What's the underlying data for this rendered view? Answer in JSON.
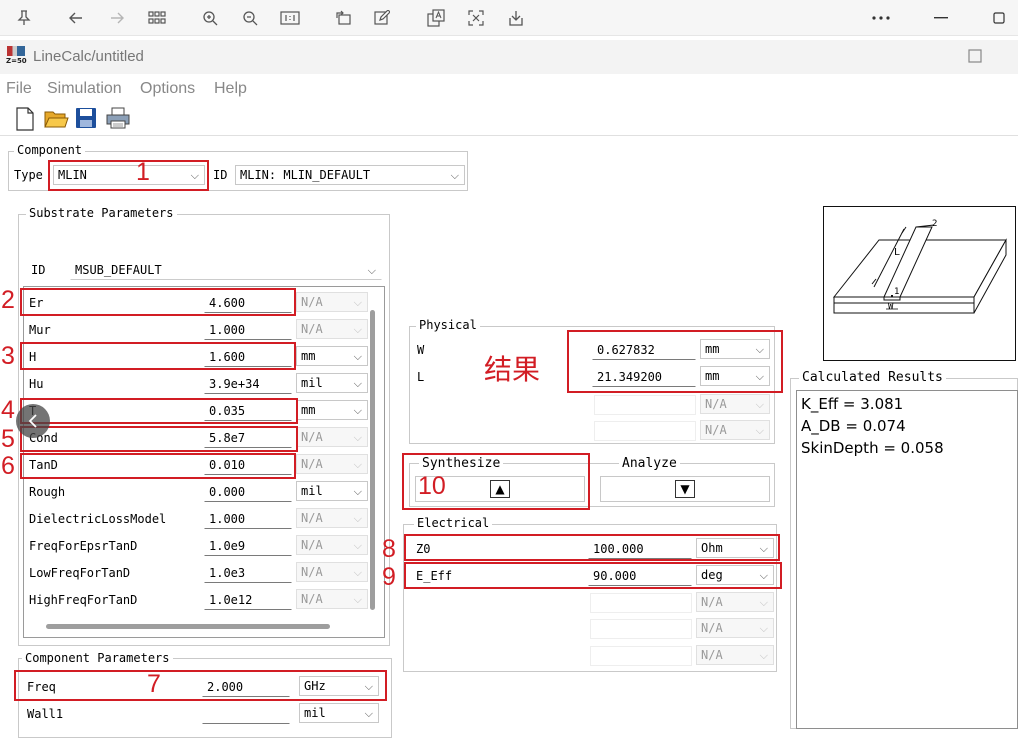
{
  "viewer_toolbar": {
    "icons": [
      "pin-icon",
      "back-arrow-icon",
      "forward-arrow-icon",
      "grid-icon",
      "zoom-in-icon",
      "zoom-out-icon",
      "actual-size-icon",
      "rotate-icon",
      "edit-icon",
      "translate-icon",
      "crop-icon",
      "download-icon",
      "more-icon",
      "maximize-icon"
    ]
  },
  "app": {
    "title": "LineCalc/untitled",
    "icon_text": "Z=50"
  },
  "menu": [
    "File",
    "Simulation",
    "Options",
    "Help"
  ],
  "component": {
    "group_title": "Component",
    "type_label": "Type",
    "type_value": "MLIN",
    "id_label": "ID",
    "id_value": "MLIN: MLIN_DEFAULT"
  },
  "substrate": {
    "group_title": "Substrate Parameters",
    "id_label": "ID",
    "id_value": "MSUB_DEFAULT",
    "rows": [
      {
        "name": "Er",
        "value": "4.600",
        "unit": "N/A",
        "unit_enabled": false
      },
      {
        "name": "Mur",
        "value": "1.000",
        "unit": "N/A",
        "unit_enabled": false
      },
      {
        "name": "H",
        "value": "1.600",
        "unit": "mm",
        "unit_enabled": true
      },
      {
        "name": "Hu",
        "value": "3.9e+34",
        "unit": "mil",
        "unit_enabled": true
      },
      {
        "name": "T",
        "value": "0.035",
        "unit": "mm",
        "unit_enabled": true
      },
      {
        "name": "Cond",
        "value": "5.8e7",
        "unit": "N/A",
        "unit_enabled": false
      },
      {
        "name": "TanD",
        "value": "0.010",
        "unit": "N/A",
        "unit_enabled": false
      },
      {
        "name": "Rough",
        "value": "0.000",
        "unit": "mil",
        "unit_enabled": true
      },
      {
        "name": "DielectricLossModel",
        "value": "1.000",
        "unit": "N/A",
        "unit_enabled": false
      },
      {
        "name": "FreqForEpsrTanD",
        "value": "1.0e9",
        "unit": "N/A",
        "unit_enabled": false
      },
      {
        "name": "LowFreqForTanD",
        "value": "1.0e3",
        "unit": "N/A",
        "unit_enabled": false
      },
      {
        "name": "HighFreqForTanD",
        "value": "1.0e12",
        "unit": "N/A",
        "unit_enabled": false
      }
    ]
  },
  "component_params": {
    "group_title": "Component Parameters",
    "rows": [
      {
        "name": "Freq",
        "value": "2.000",
        "unit": "GHz"
      },
      {
        "name": "Wall1",
        "value": "",
        "unit": "mil"
      }
    ]
  },
  "physical": {
    "group_title": "Physical",
    "rows": [
      {
        "name": "W",
        "value": "0.627832",
        "unit": "mm"
      },
      {
        "name": "L",
        "value": "21.349200",
        "unit": "mm"
      }
    ],
    "extra_units": [
      "N/A",
      "N/A"
    ]
  },
  "actions": {
    "synthesize_label": "Synthesize",
    "synthesize_glyph": "▲",
    "analyze_label": "Analyze",
    "analyze_glyph": "▼"
  },
  "electrical": {
    "group_title": "Electrical",
    "rows": [
      {
        "name": "Z0",
        "value": "100.000",
        "unit": "Ohm"
      },
      {
        "name": "E_Eff",
        "value": "90.000",
        "unit": "deg"
      }
    ],
    "extra_units": [
      "N/A",
      "N/A",
      "N/A"
    ]
  },
  "diagram": {
    "label_L": "L",
    "label_W": "W",
    "label_1": "1",
    "label_2": "2"
  },
  "results": {
    "title": "Calculated Results",
    "lines": [
      "K_Eff = 3.081",
      "A_DB = 0.074",
      "SkinDepth = 0.058"
    ]
  },
  "annotations": {
    "numbers": [
      "1",
      "2",
      "3",
      "4",
      "5",
      "6",
      "7",
      "8",
      "9",
      "10"
    ],
    "result_label": "结果",
    "color": "#d21d24"
  }
}
